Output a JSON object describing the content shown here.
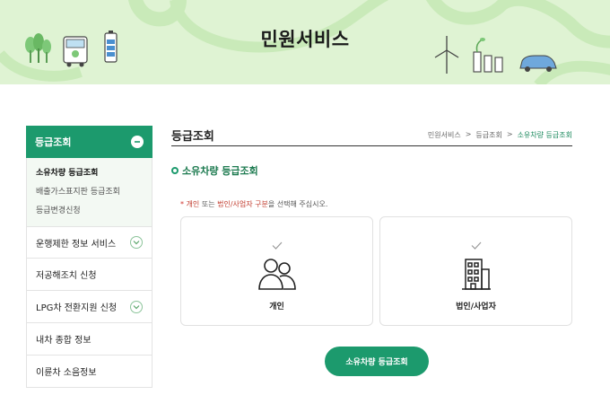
{
  "banner": {
    "title": "민원서비스"
  },
  "sidebar": {
    "active_label": "등급조회",
    "sub_items": [
      "소유차량 등급조회",
      "배출가스표지판 등급조회",
      "등급변경신청"
    ],
    "items": [
      {
        "label": "운행제한 정보 서비스",
        "expandable": true
      },
      {
        "label": "저공해조치 신청",
        "expandable": false
      },
      {
        "label": "LPG차 전환지원 신청",
        "expandable": true
      },
      {
        "label": "내차 종합 정보",
        "expandable": false
      },
      {
        "label": "이륜차 소음정보",
        "expandable": false
      }
    ]
  },
  "main": {
    "title": "등급조회",
    "breadcrumb": [
      "민원서비스",
      ">",
      "등급조회",
      ">",
      "소유차량 등급조회"
    ],
    "subtitle": "소유차량 등급조회",
    "notice": {
      "required_mark": "*",
      "opt1": "개인",
      "text1": "또는",
      "opt2": "법인/사업자 구분",
      "text2": "을 선택해 주십시오."
    },
    "cards": [
      {
        "label": "개인",
        "icon": "people-icon"
      },
      {
        "label": "법인/사업자",
        "icon": "building-icon"
      }
    ],
    "submit_label": "소유차량 등급조회"
  },
  "colors": {
    "accent": "#1c9a6d",
    "banner_bg": "#dff3d3",
    "breadcrumb_current": "#1c8a5e"
  }
}
